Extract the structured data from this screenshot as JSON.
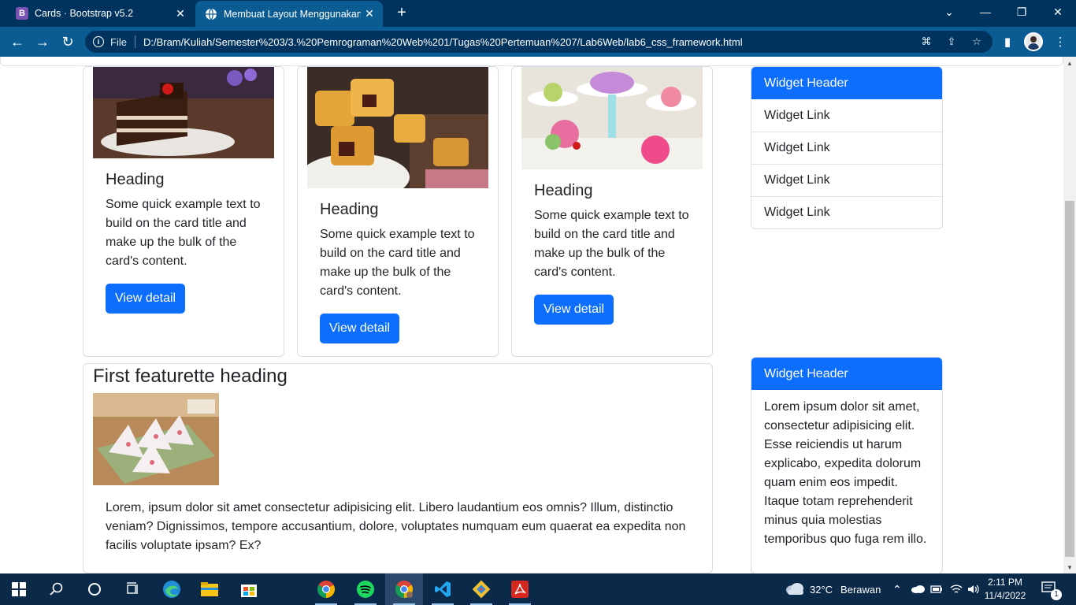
{
  "browser": {
    "tabs": [
      {
        "title": "Cards · Bootstrap v5.2",
        "favicon": "B",
        "active": false
      },
      {
        "title": "Membuat Layout Menggunakan",
        "favicon": "globe",
        "active": true
      }
    ],
    "address": {
      "scheme_label": "File",
      "url": "D:/Bram/Kuliah/Semester%203/3.%20Pemrograman%20Web%201/Tugas%20Pertemuan%207/Lab6Web/lab6_css_framework.html"
    }
  },
  "cards": [
    {
      "heading": "Heading",
      "text": "Some quick example text to build on the card title and make up the bulk of the card's content.",
      "button": "View detail",
      "image_icon": "chocolate-cake-image"
    },
    {
      "heading": "Heading",
      "text": "Some quick example text to build on the card title and make up the bulk of the card's content.",
      "button": "View detail",
      "image_icon": "pineapple-cookies-image"
    },
    {
      "heading": "Heading",
      "text": "Some quick example text to build on the card title and make up the bulk of the card's content.",
      "button": "View detail",
      "image_icon": "cake-platter-image"
    }
  ],
  "featurette": {
    "heading": "First featurette heading",
    "text": "Lorem, ipsum dolor sit amet consectetur adipisicing elit. Libero laudantium eos omnis? Illum, distinctio veniam? Dignissimos, tempore accusantium, dolore, voluptates numquam eum quaerat ea expedita non facilis voluptate ipsam? Ex?",
    "image_icon": "pyramid-dessert-image"
  },
  "widgets": [
    {
      "header": "Widget Header",
      "links": [
        "Widget Link",
        "Widget Link",
        "Widget Link",
        "Widget Link"
      ]
    },
    {
      "header": "Widget Header",
      "text": "Lorem ipsum dolor sit amet, consectetur adipisicing elit. Esse reiciendis ut harum explicabo, expedita dolorum quam enim eos impedit. Itaque totam reprehenderit minus quia molestias temporibus quo fuga rem illo."
    }
  ],
  "taskbar": {
    "weather_temp": "32°C",
    "weather_text": "Berawan",
    "time": "2:11 PM",
    "date": "11/4/2022",
    "notification_count": "1"
  },
  "colors": {
    "primary": "#0d6efd",
    "chrome_dark": "#00345f",
    "chrome_mid": "#0a5c93",
    "taskbar": "#0b2a4a"
  }
}
